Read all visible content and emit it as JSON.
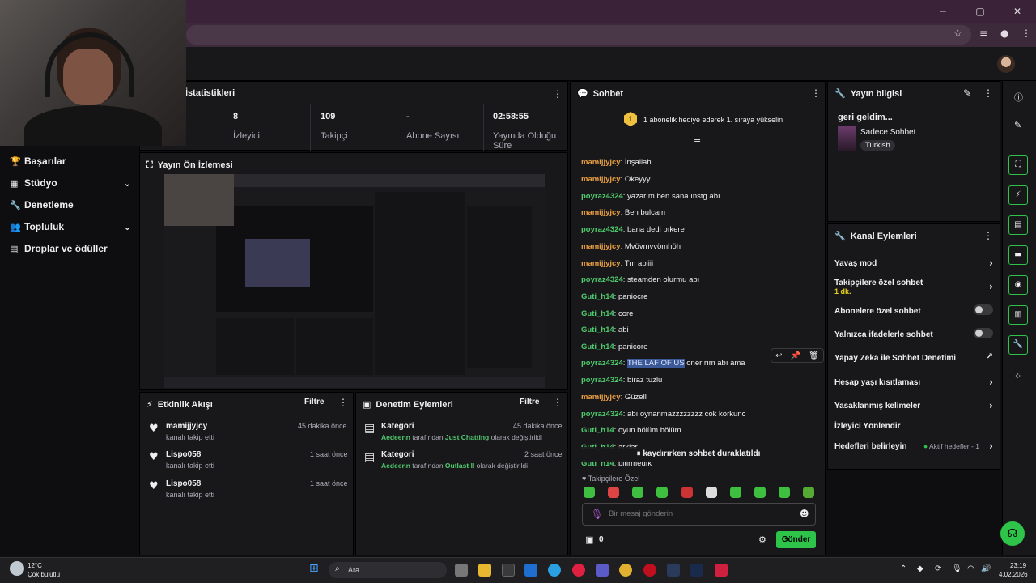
{
  "nav": {
    "items": [
      {
        "label": "Başarılar",
        "icon": "trophy-icon"
      },
      {
        "label": "Stüdyo",
        "icon": "studio-icon"
      },
      {
        "label": "Denetleme",
        "icon": "wrench-icon"
      },
      {
        "label": "Topluluk",
        "icon": "community-icon"
      },
      {
        "label": "Droplar ve ödüller",
        "icon": "gift-icon"
      }
    ]
  },
  "stats": {
    "title": "İstatistikleri",
    "items": [
      {
        "value": "8",
        "label": "İzleyici"
      },
      {
        "value": "109",
        "label": "Takipçi"
      },
      {
        "value": "-",
        "label": "Abone Sayısı"
      },
      {
        "value": "02:58:55",
        "label": "Yayında Olduğu Süre"
      }
    ]
  },
  "preview": {
    "title": "Yayın Ön İzlemesi"
  },
  "activity": {
    "title": "Etkinlik Akışı",
    "filter": "Filtre",
    "items": [
      {
        "name": "mamijjyjcy",
        "action": "kanalı takip etti",
        "time": "45 dakika önce"
      },
      {
        "name": "Lispo058",
        "action": "kanalı takip etti",
        "time": "1 saat önce"
      },
      {
        "name": "Lispo058",
        "action": "kanalı takip etti",
        "time": "1 saat önce"
      }
    ]
  },
  "moderation": {
    "title": "Denetim Eylemleri",
    "filter": "Filtre",
    "items": [
      {
        "title": "Kategori",
        "time": "45 dakika önce",
        "actor": "Aedeenn",
        "mid": " tarafından ",
        "target": "Just Chatting",
        "tail": " olarak değiştirildi"
      },
      {
        "title": "Kategori",
        "time": "2 saat önce",
        "actor": "Aedeenn",
        "mid": " tarafından ",
        "target": "Outlast II",
        "tail": " olarak değiştirildi"
      }
    ]
  },
  "chat": {
    "title": "Sohbet",
    "sub_banner": "1 abonelik hediye ederek 1. sıraya yükselin",
    "sub_badge": "1",
    "messages": [
      {
        "user": "mamijjyjcy",
        "color": "orange",
        "text": "İnşallah"
      },
      {
        "user": "mamijjyjcy",
        "color": "orange",
        "text": "Okeyyy"
      },
      {
        "user": "poyraz4324",
        "color": "green",
        "text": "yazarım ben sana ınstg abı"
      },
      {
        "user": "mamijjyjcy",
        "color": "orange",
        "text": "Ben bulcam"
      },
      {
        "user": "poyraz4324",
        "color": "green",
        "text": "bana dedi bıkere"
      },
      {
        "user": "mamijjyjcy",
        "color": "orange",
        "text": "Mvövmvvömhöh"
      },
      {
        "user": "mamijjyjcy",
        "color": "orange",
        "text": "Tm abiiii"
      },
      {
        "user": "poyraz4324",
        "color": "green",
        "text": "steamden olurmu abı"
      },
      {
        "user": "Guti_h14",
        "color": "green",
        "text": "paniocre"
      },
      {
        "user": "Guti_h14",
        "color": "green",
        "text": "core"
      },
      {
        "user": "Guti_h14",
        "color": "green",
        "text": "abi"
      },
      {
        "user": "Guti_h14",
        "color": "green",
        "text": "panicore"
      },
      {
        "user": "poyraz4324",
        "color": "green",
        "text_hl": "THE LAF OF US",
        "text": " onerırım abı ama"
      },
      {
        "user": "poyraz4324",
        "color": "green",
        "text": "biraz tuzlu"
      },
      {
        "user": "mamijjyjcy",
        "color": "orange",
        "text": "Güzell"
      },
      {
        "user": "poyraz4324",
        "color": "green",
        "text": "abı oynanmazzzzzzzz cok korkunc"
      },
      {
        "user": "Guti_h14",
        "color": "green",
        "text": "oyun bölüm bölüm"
      },
      {
        "user": "Guti_h14",
        "color": "green",
        "text": "arklar..."
      },
      {
        "user": "Guti_h14",
        "color": "green",
        "text": "bitirmedık"
      }
    ],
    "paused": "kaydırırken sohbet duraklatıldı",
    "followers_only": "Takipçilere Özel",
    "input_placeholder": "Bir mesaj gönderin",
    "points": "0",
    "send_label": "Gönder"
  },
  "stream_info": {
    "title": "Yayın bilgisi",
    "stream_title": "geri geldim...",
    "category": "Sadece Sohbet",
    "tag": "Turkish"
  },
  "channel_actions": {
    "title": "Kanal Eylemleri",
    "items": [
      {
        "label": "Yavaş mod",
        "type": "chevron"
      },
      {
        "label": "Takipçilere özel sohbet",
        "sub": "1 dk.",
        "type": "chevron"
      },
      {
        "label": "Abonelere özel sohbet",
        "type": "toggle"
      },
      {
        "label": "Yalnızca ifadelerle sohbet",
        "type": "toggle"
      },
      {
        "label": "Yapay Zeka ile Sohbet Denetimi",
        "type": "external"
      },
      {
        "label": "Hesap yaşı kısıtlaması",
        "type": "chevron"
      },
      {
        "label": "Yasaklanmış kelimeler",
        "type": "chevron"
      },
      {
        "label": "İzleyici Yönlendir",
        "type": "none"
      },
      {
        "label": "Hedefleri belirleyin",
        "badge": "Aktif hedefler - 1",
        "type": "chevron"
      }
    ]
  },
  "taskbar": {
    "weather_temp": "12°C",
    "weather_text": "Çok bulutlu",
    "search_placeholder": "Ara",
    "time": "23:19",
    "date": "4.02.2026"
  },
  "colors": {
    "accent_green": "#2ec44a",
    "username_orange": "#e89f43",
    "username_green": "#4fcb6e",
    "panel_bg": "#18181b"
  }
}
